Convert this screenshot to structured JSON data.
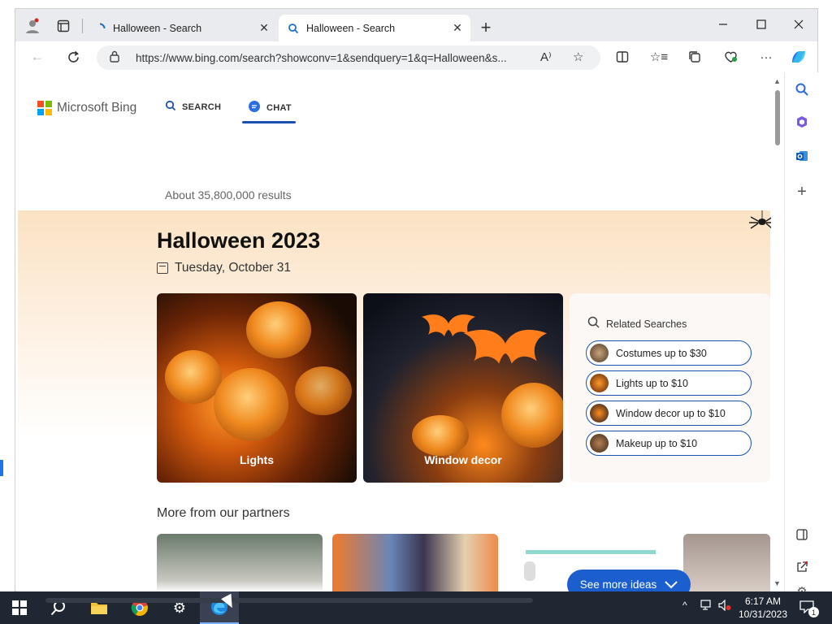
{
  "tabs": [
    {
      "title": "Halloween - Search",
      "active": false
    },
    {
      "title": "Halloween - Search",
      "active": true
    }
  ],
  "address": {
    "url": "https://www.bing.com/search?showconv=1&sendquery=1&q=Halloween&s..."
  },
  "bing": {
    "logo_text": "Microsoft Bing",
    "scopes": [
      {
        "label": "SEARCH",
        "active": false
      },
      {
        "label": "CHAT",
        "active": true
      }
    ],
    "results_count": "About 35,800,000 results"
  },
  "hero": {
    "title": "Halloween 2023",
    "date": "Tuesday, October 31",
    "cards": [
      {
        "caption": "Lights"
      },
      {
        "caption": "Window decor"
      }
    ],
    "related": {
      "title": "Related Searches",
      "items": [
        "Costumes up to $30",
        "Lights up to $10",
        "Window decor up to $10",
        "Makeup up to $10"
      ]
    }
  },
  "partners": {
    "title": "More from our partners",
    "see_more": "See more ideas"
  },
  "taskbar": {
    "time": "6:17 AM",
    "date": "10/31/2023",
    "notification_count": "1"
  },
  "colors": {
    "accent": "#1b50ae",
    "see_more_bg": "#1b5fcf",
    "taskbar": "#1f2733",
    "hero_top": "#fbe2c3"
  }
}
